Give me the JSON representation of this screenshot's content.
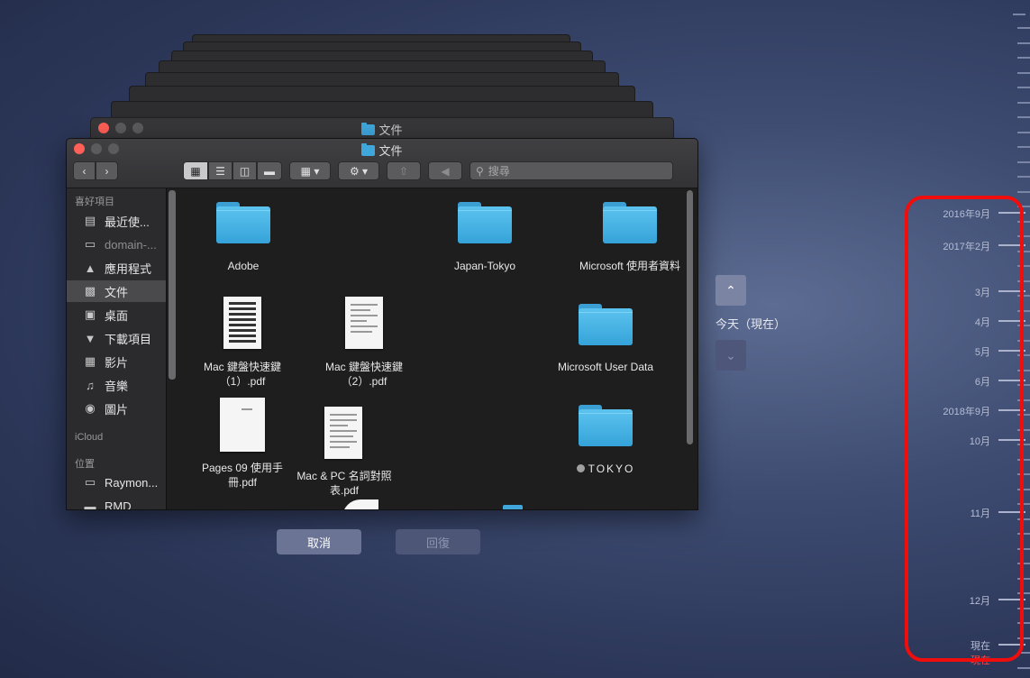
{
  "back_window": {
    "title": "文件"
  },
  "finder": {
    "title": "文件",
    "search_placeholder": "搜尋",
    "sidebar": {
      "favorites_label": "喜好項目",
      "icloud_label": "iCloud",
      "locations_label": "位置",
      "favorites": [
        {
          "label": "最近使...",
          "icon": "recents-icon"
        },
        {
          "label": "domain-...",
          "icon": "document-icon"
        },
        {
          "label": "應用程式",
          "icon": "applications-icon"
        },
        {
          "label": "文件",
          "icon": "documents-icon"
        },
        {
          "label": "桌面",
          "icon": "desktop-icon"
        },
        {
          "label": "下載項目",
          "icon": "downloads-icon"
        },
        {
          "label": "影片",
          "icon": "movies-icon"
        },
        {
          "label": "音樂",
          "icon": "music-icon"
        },
        {
          "label": "圖片",
          "icon": "pictures-icon"
        }
      ],
      "locations": [
        {
          "label": "Raymon...",
          "icon": "laptop-icon"
        },
        {
          "label": "RMD",
          "icon": "drive-icon"
        }
      ]
    },
    "files": [
      {
        "name": "Adobe",
        "kind": "folder"
      },
      {
        "name": "Japan-Tokyo",
        "kind": "folder"
      },
      {
        "name": "Microsoft 使用者資料",
        "kind": "folder"
      },
      {
        "name": "Mac 鍵盤快速鍵（1）.pdf",
        "kind": "pdf"
      },
      {
        "name": "Mac 鍵盤快速鍵（2）.pdf",
        "kind": "pdf"
      },
      {
        "name": "Microsoft User Data",
        "kind": "folder"
      },
      {
        "name": "Pages 09 使用手冊.pdf",
        "kind": "pdf"
      },
      {
        "name": "Mac & PC 名詞對照表.pdf",
        "kind": "pdf"
      },
      {
        "name": "TOKYO",
        "kind": "folder",
        "tag": "gray"
      }
    ]
  },
  "controls": {
    "cancel_label": "取消",
    "restore_label": "回復",
    "today_label": "今天（現在）"
  },
  "timeline": [
    {
      "label": "2016年9月"
    },
    {
      "label": "2017年2月"
    },
    {
      "label": "3月"
    },
    {
      "label": "4月"
    },
    {
      "label": "5月"
    },
    {
      "label": "6月"
    },
    {
      "label": "2018年9月"
    },
    {
      "label": "10月"
    },
    {
      "label": "11月"
    },
    {
      "label": "12月"
    },
    {
      "label": "現在"
    },
    {
      "label": "現在"
    }
  ],
  "colors": {
    "highlight": "#f20d0d",
    "folder": "#3fa7dc"
  }
}
